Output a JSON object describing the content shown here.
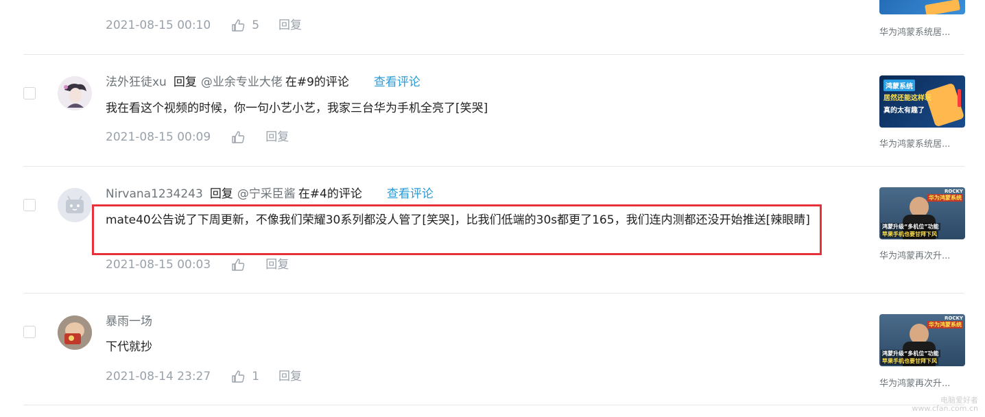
{
  "comments": [
    {
      "username": "",
      "reply_word": "",
      "mention": "",
      "context": "",
      "view_link": "",
      "content": "",
      "date": "2021-08-15 00:10",
      "likes": "5",
      "reply_label": "回复",
      "video_title": "华为鸿蒙系统居..."
    },
    {
      "username": "法外狂徒xu",
      "reply_word": "回复",
      "mention": "@业余专业大佬",
      "context": "在#9的评论",
      "view_link": "查看评论",
      "content": "我在看这个视频的时候，你一句小艺小艺，我家三台华为手机全亮了[笑哭]",
      "date": "2021-08-15 00:09",
      "likes": "",
      "reply_label": "回复",
      "video_title": "华为鸿蒙系统居...",
      "thumb_text": {
        "line1": "鸿蒙系统",
        "line2": "居然还能这样玩",
        "line3": "真的太有趣了"
      }
    },
    {
      "username": "Nirvana1234243",
      "reply_word": "回复",
      "mention": "@宁采臣酱",
      "context": "在#4的评论",
      "view_link": "查看评论",
      "content": "mate40公告说了下周更新，不像我们荣耀30系列都没人管了[笑哭]，比我们低端的30s都更了165，我们连内测都还没开始推送[辣眼睛]",
      "date": "2021-08-15 00:03",
      "likes": "",
      "reply_label": "回复",
      "video_title": "华为鸿蒙再次升...",
      "thumb_text": {
        "line1": "华为鸿蒙系统",
        "line2": "鸿蒙升级“多机位”功能",
        "line3": "苹果手机也要甘拜下风",
        "brand": "ROCKY"
      }
    },
    {
      "username": "暴雨一场",
      "reply_word": "",
      "mention": "",
      "context": "",
      "view_link": "",
      "content": "下代就抄",
      "date": "2021-08-14 23:27",
      "likes": "1",
      "reply_label": "回复",
      "video_title": "华为鸿蒙再次升...",
      "thumb_text": {
        "line1": "华为鸿蒙系统",
        "line2": "鸿蒙升级“多机位”功能",
        "line3": "苹果手机也要甘拜下风",
        "brand": "ROCKY"
      }
    }
  ],
  "watermark": {
    "line1": "电脑爱好者",
    "line2": "www.cfan.com.cn"
  },
  "colors": {
    "link": "#2a9bd6",
    "highlight": "#e8303a",
    "meta": "#99a2aa",
    "username": "#6d757a"
  }
}
